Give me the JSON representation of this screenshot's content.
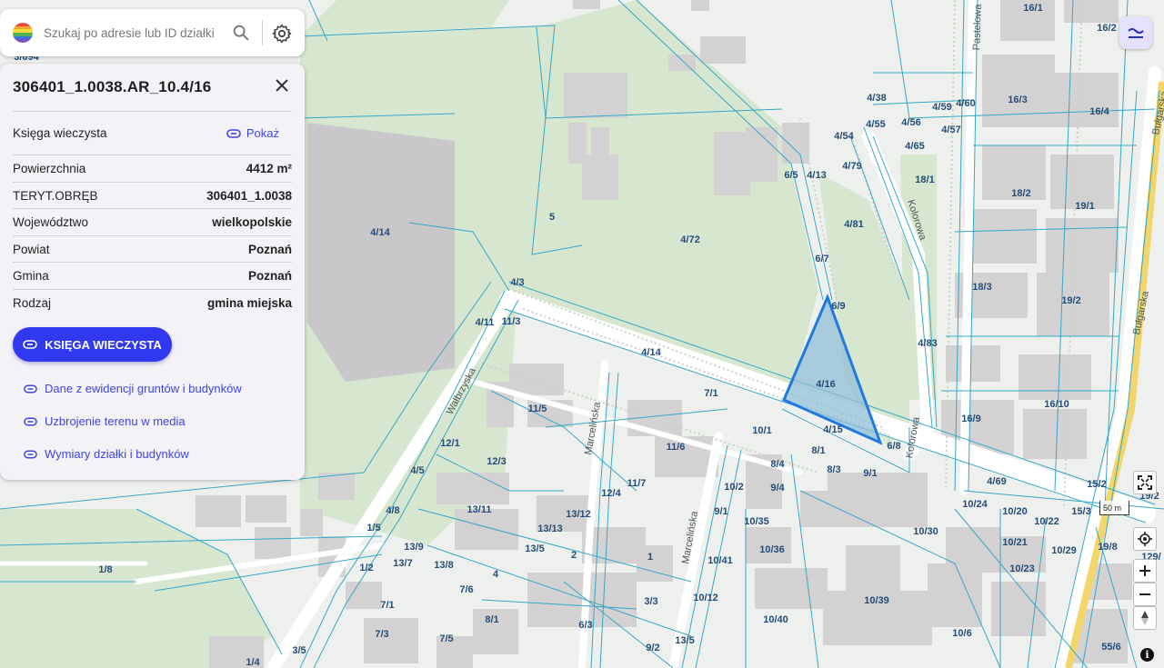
{
  "search": {
    "placeholder": "Szukaj po adresie lub ID działki ..."
  },
  "logo_colors": [
    "#e8483a",
    "#f2a531",
    "#f7d93a",
    "#4fb35a",
    "#3a6fd8",
    "#7a4fc2"
  ],
  "panel": {
    "title": "306401_1.0038.AR_10.4/16",
    "kw_label": "Księga wieczysta",
    "kw_link": "Pokaż",
    "rows": [
      {
        "label": "Powierzchnia",
        "value": "4412 m²"
      },
      {
        "label": "TERYT.OBRĘB",
        "value": "306401_1.0038"
      },
      {
        "label": "Województwo",
        "value": "wielkopolskie"
      },
      {
        "label": "Powiat",
        "value": "Poznań"
      },
      {
        "label": "Gmina",
        "value": "Poznań"
      },
      {
        "label": "Rodzaj",
        "value": "gmina miejska"
      }
    ],
    "button": "KSIĘGA WIECZYSTA",
    "links": [
      "Dane z ewidencji gruntów i budynków",
      "Uzbrojenie terenu w media",
      "Wymiary działki i budynków"
    ]
  },
  "map": {
    "scale_label": "50 m",
    "accent_color": "#3038f0",
    "selected_parcel_color": "#1f7ae0",
    "streets": [
      "Wałbrzyska",
      "Marcelińska",
      "Marcelińska",
      "Kolorowa",
      "Kolorowa",
      "Bułgarska",
      "Bułgarska",
      "Pastelowa"
    ],
    "parcels": [
      "4/16",
      "4/72",
      "4/14",
      "5",
      "4/3",
      "4/11",
      "11/3",
      "4/14",
      "7/1",
      "10/1",
      "8/1",
      "8/4",
      "8/3",
      "9/1",
      "4/15",
      "6/8",
      "6/9",
      "6/7",
      "6/5",
      "4/13",
      "4/79",
      "4/81",
      "4/54",
      "4/55",
      "4/38",
      "4/56",
      "4/65",
      "4/57",
      "4/59",
      "4/60",
      "16/1",
      "16/2",
      "16/3",
      "16/4",
      "18/1",
      "18/2",
      "19/1",
      "18/3",
      "19/2",
      "4/83",
      "16/10",
      "16/9",
      "4/69",
      "15/2",
      "19/2",
      "10/24",
      "10/20",
      "10/22",
      "15/3",
      "19/8",
      "129/",
      "10/21",
      "10/29",
      "10/23",
      "10/30",
      "10/35",
      "10/36",
      "10/41",
      "10/39",
      "10/12",
      "10/40",
      "10/6",
      "55/6",
      "13/5",
      "2",
      "1",
      "3/3",
      "4",
      "13/8",
      "13/13",
      "13/12",
      "13/11",
      "12/3",
      "12/1",
      "12/4",
      "11/7",
      "11/5",
      "11/6",
      "10/2",
      "9/4",
      "9/1",
      "4/5",
      "4/8",
      "1/5",
      "13/9",
      "13/7",
      "1/2",
      "7/6",
      "7/1",
      "7/3",
      "7/5",
      "8/1",
      "6/3",
      "9/2",
      "13/5",
      "1/8",
      "1/4",
      "3/5",
      "3/694"
    ]
  }
}
